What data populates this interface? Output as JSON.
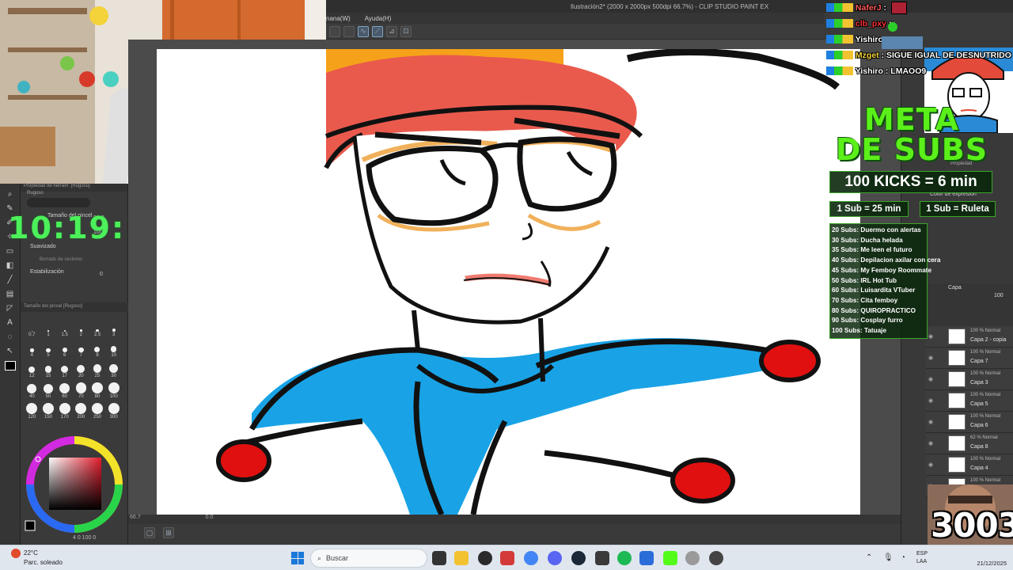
{
  "window": {
    "title": "Ilustración2* (2000 x 2000px 500dpi 66.7%) - CLIP STUDIO PAINT EX"
  },
  "menu": {
    "items": [
      "nana(W)",
      "Ayuda(H)"
    ]
  },
  "timer": {
    "value": "10:19:16"
  },
  "subtool": {
    "header": "Propiedad de herram: [Rugoso]",
    "brush_name": "Rugoso",
    "brush_size_label": "Tamaño del pincel",
    "brush_size_value": "80.0",
    "density_value": "100",
    "smoothing_label": "Suavizado",
    "vector_erase_label": "Borrado de vectores",
    "stabilization_label": "Estabilización",
    "stabilization_value": "0",
    "brush_size_panel_label": "Tamaño del pincel [Rugoso]",
    "brush_sizes": [
      "0.7",
      "1",
      "1.5",
      "2",
      "2.5",
      "3",
      "4",
      "5",
      "6",
      "7",
      "8",
      "10",
      "12",
      "15",
      "17",
      "20",
      "25",
      "30",
      "40",
      "50",
      "60",
      "70",
      "80",
      "100",
      "120",
      "150",
      "170",
      "200",
      "250",
      "300"
    ]
  },
  "color": {
    "primary": "#000000",
    "secondary": "#ffffff",
    "status": "4 0 100 0"
  },
  "statusbar": {
    "zoom": "66.7",
    "coords": "0.0"
  },
  "layers": {
    "header": "Capa",
    "opacity": "100",
    "items": [
      {
        "mode": "100 % Normal",
        "name": "Capa 2 - copia"
      },
      {
        "mode": "100 % Normal",
        "name": "Capa 7"
      },
      {
        "mode": "100 % Normal",
        "name": "Capa 3"
      },
      {
        "mode": "100 % Normal",
        "name": "Capa 5"
      },
      {
        "mode": "100 % Normal",
        "name": "Capa 6"
      },
      {
        "mode": "62 % Normal",
        "name": "Capa 8"
      },
      {
        "mode": "100 % Normal",
        "name": "Capa 4"
      },
      {
        "mode": "100 % Normal",
        "name": ""
      }
    ]
  },
  "right_panel": {
    "property_label": "Propiedad",
    "expression_color_label": "Color de expresión"
  },
  "chat": [
    {
      "user": "NaferJ",
      "message": "",
      "color": "#ff5a5a"
    },
    {
      "user": "clb_pxy",
      "message": "",
      "color": "#ff3030"
    },
    {
      "user": "Yishiro",
      "message": "",
      "color": "#ffffff"
    },
    {
      "user": "Mzget",
      "message": "SIGUE IGUAL DE DESNUTRIDO",
      "color": "#f2d23a"
    },
    {
      "user": "Yishiro",
      "message": "LMAOO9",
      "color": "#ffffff"
    }
  ],
  "overlay": {
    "meta_line1": "META",
    "meta_line2": "DE SUBS",
    "kicks": "100 KICKS = 6 min",
    "sub_time": "1 Sub = 25 min",
    "sub_roulette": "1 Sub = Ruleta",
    "goals": [
      "20 Subs: Duermo con alertas",
      "30 Subs: Ducha helada",
      "35 Subs: Me leen el futuro",
      "40 Subs: Depilacion axilar con cera",
      "45 Subs: My Femboy Roommate",
      "50 Subs: IRL Hot Tub",
      "60 Subs: Luisardita VTuber",
      "70 Subs: Cita femboy",
      "80 Subs: QUIROPRACTICO",
      "90 Subs: Cosplay furro",
      "100 Subs: Tatuaje"
    ],
    "sub_count": "3003",
    "accent": "#5bf01a"
  },
  "taskbar": {
    "temperature": "22°C",
    "weather": "Parc. soleado",
    "search_placeholder": "Buscar",
    "lang_line1": "ESP",
    "lang_line2": "LAA",
    "date": "21/12/2025"
  }
}
